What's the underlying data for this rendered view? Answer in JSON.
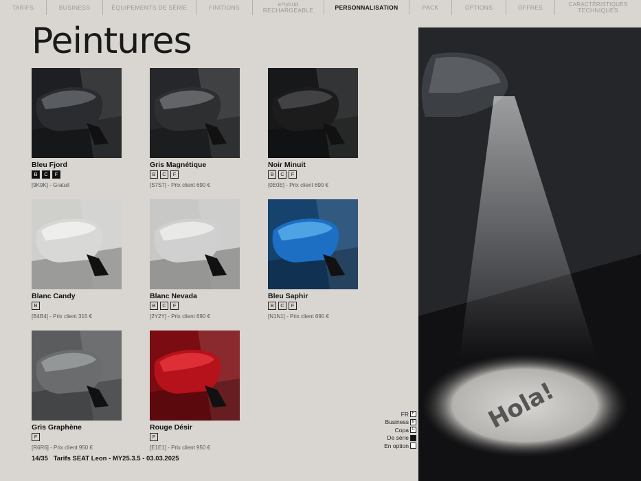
{
  "nav": [
    {
      "label": "TARIFS",
      "sup": "",
      "active": false
    },
    {
      "label": "BUSINESS",
      "sup": "",
      "active": false
    },
    {
      "label": "ÉQUIPEMENTS DE SÉRIE",
      "sup": "",
      "active": false
    },
    {
      "label": "FINITIONS",
      "sup": "",
      "active": false
    },
    {
      "label": "RECHARGEABLE",
      "sup": "eHybrid",
      "active": false
    },
    {
      "label": "PERSONNALISATION",
      "sup": "",
      "active": true
    },
    {
      "label": "PACK",
      "sup": "",
      "active": false
    },
    {
      "label": "OPTIONS",
      "sup": "",
      "active": false
    },
    {
      "label": "OFFRES",
      "sup": "",
      "active": false
    },
    {
      "label": "TECHNIQUES",
      "sup": "CARACTÉRISTIQUES",
      "active": false
    }
  ],
  "title": "Peintures",
  "paints": [
    {
      "name": "Bleu Fjord",
      "badges": [
        "B",
        "C",
        "F"
      ],
      "filled": true,
      "code": "[9K9K] - Gratuit",
      "color": "#2a2c30",
      "highlight": "#6a6d72"
    },
    {
      "name": "Gris Magnétique",
      "badges": [
        "B",
        "C",
        "F"
      ],
      "filled": false,
      "code": "[S7S7] - Prix client 690 €",
      "color": "#2e2f31",
      "highlight": "#75777a"
    },
    {
      "name": "Noir Minuit",
      "badges": [
        "B",
        "C",
        "F"
      ],
      "filled": false,
      "code": "[0E0E] - Prix client 690 €",
      "color": "#1c1c1d",
      "highlight": "#4f4f52"
    },
    {
      "name": "Blanc Candy",
      "badges": [
        "B"
      ],
      "filled": false,
      "code": "[B4B4] - Prix client 315 €",
      "color": "#d8d8d6",
      "highlight": "#f6f6f4"
    },
    {
      "name": "Blanc Nevada",
      "badges": [
        "B",
        "C",
        "F"
      ],
      "filled": false,
      "code": "[2Y2Y] - Prix client 690 €",
      "color": "#cfd0cf",
      "highlight": "#f2f2f0"
    },
    {
      "name": "Bleu Saphir",
      "badges": [
        "B",
        "C",
        "F"
      ],
      "filled": false,
      "code": "[N1N1] - Prix client 690 €",
      "color": "#1c6fc2",
      "highlight": "#5fb4f0"
    },
    {
      "name": "Gris Graphène",
      "badges": [
        "F"
      ],
      "filled": false,
      "code": "[R6R6] - Prix client 950 €",
      "color": "#6a6c6e",
      "highlight": "#a3a5a7"
    },
    {
      "name": "Rouge Désir",
      "badges": [
        "F"
      ],
      "filled": false,
      "code": "[E1E1] - Prix client 950 €",
      "color": "#b5121b",
      "highlight": "#ec3a40"
    }
  ],
  "legend": [
    {
      "label": "FR",
      "box": "F",
      "filled": false
    },
    {
      "label": "Business",
      "box": "B",
      "filled": false
    },
    {
      "label": "Copa",
      "box": "C",
      "filled": false
    },
    {
      "label": "De série",
      "box": "",
      "filled": true
    },
    {
      "label": "En option",
      "box": "",
      "filled": false
    }
  ],
  "footer": {
    "page": "14/35",
    "text": "Tarifs SEAT Leon - MY25.3.5 - 03.03.2025"
  },
  "photo": {
    "projection_text": "Hola!"
  }
}
